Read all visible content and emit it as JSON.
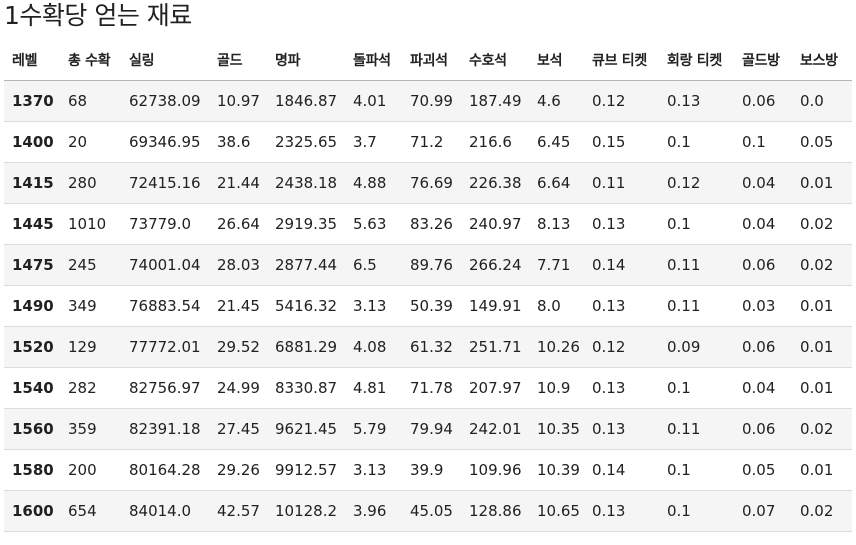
{
  "title": "1수확당 얻는 재료",
  "table": {
    "headers": [
      "레벨",
      "총 수확",
      "실링",
      "골드",
      "명파",
      "돌파석",
      "파괴석",
      "수호석",
      "보석",
      "큐브 티켓",
      "회랑 티켓",
      "골드방",
      "보스방"
    ],
    "rows": [
      [
        "1370",
        "68",
        "62738.09",
        "10.97",
        "1846.87",
        "4.01",
        "70.99",
        "187.49",
        "4.6",
        "0.12",
        "0.13",
        "0.06",
        "0.0"
      ],
      [
        "1400",
        "20",
        "69346.95",
        "38.6",
        "2325.65",
        "3.7",
        "71.2",
        "216.6",
        "6.45",
        "0.15",
        "0.1",
        "0.1",
        "0.05"
      ],
      [
        "1415",
        "280",
        "72415.16",
        "21.44",
        "2438.18",
        "4.88",
        "76.69",
        "226.38",
        "6.64",
        "0.11",
        "0.12",
        "0.04",
        "0.01"
      ],
      [
        "1445",
        "1010",
        "73779.0",
        "26.64",
        "2919.35",
        "5.63",
        "83.26",
        "240.97",
        "8.13",
        "0.13",
        "0.1",
        "0.04",
        "0.02"
      ],
      [
        "1475",
        "245",
        "74001.04",
        "28.03",
        "2877.44",
        "6.5",
        "89.76",
        "266.24",
        "7.71",
        "0.14",
        "0.11",
        "0.06",
        "0.02"
      ],
      [
        "1490",
        "349",
        "76883.54",
        "21.45",
        "5416.32",
        "3.13",
        "50.39",
        "149.91",
        "8.0",
        "0.13",
        "0.11",
        "0.03",
        "0.01"
      ],
      [
        "1520",
        "129",
        "77772.01",
        "29.52",
        "6881.29",
        "4.08",
        "61.32",
        "251.71",
        "10.26",
        "0.12",
        "0.09",
        "0.06",
        "0.01"
      ],
      [
        "1540",
        "282",
        "82756.97",
        "24.99",
        "8330.87",
        "4.81",
        "71.78",
        "207.97",
        "10.9",
        "0.13",
        "0.1",
        "0.04",
        "0.01"
      ],
      [
        "1560",
        "359",
        "82391.18",
        "27.45",
        "9621.45",
        "5.79",
        "79.94",
        "242.01",
        "10.35",
        "0.13",
        "0.11",
        "0.06",
        "0.02"
      ],
      [
        "1580",
        "200",
        "80164.28",
        "29.26",
        "9912.57",
        "3.13",
        "39.9",
        "109.96",
        "10.39",
        "0.14",
        "0.1",
        "0.05",
        "0.01"
      ],
      [
        "1600",
        "654",
        "84014.0",
        "42.57",
        "10128.2",
        "3.96",
        "45.05",
        "128.86",
        "10.65",
        "0.13",
        "0.1",
        "0.07",
        "0.02"
      ]
    ]
  }
}
